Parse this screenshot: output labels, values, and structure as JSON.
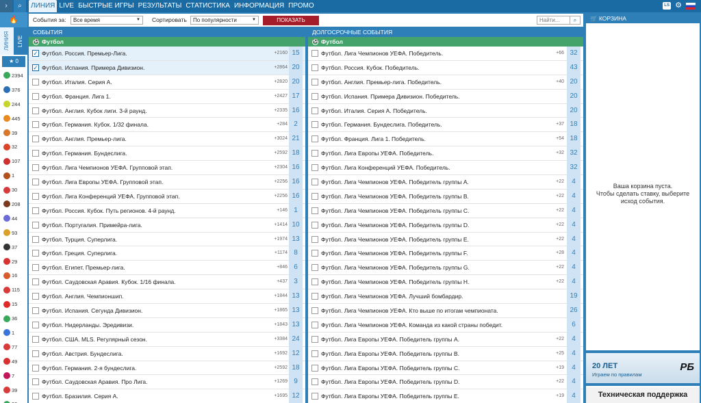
{
  "topbar": {
    "menu_icon": "chevron-right-icon",
    "search_icon": "search-icon",
    "nav": [
      "ЛИНИЯ",
      "LIVE",
      "БЫСТРЫЕ ИГРЫ",
      "РЕЗУЛЬТАТЫ",
      "СТАТИСТИКА",
      "ИНФОРМАЦИЯ",
      "ПРОМО"
    ],
    "ls_label": "LS",
    "settings_icon": "gear-icon",
    "flag_icon": "russian-flag-icon"
  },
  "leftrail": {
    "fire_icon": "fire-icon",
    "tab_line": "ЛИНИЯ",
    "tab_live": "LIVE",
    "favorites_count": "0",
    "sports": [
      {
        "icon": "soccer-ball-icon",
        "count": "2394",
        "color": "#3aa85a"
      },
      {
        "icon": "hockey-puck-icon",
        "count": "376",
        "color": "#2b6fb5"
      },
      {
        "icon": "tennis-ball-icon",
        "count": "244",
        "color": "#c5d52a"
      },
      {
        "icon": "basketball-icon",
        "count": "445",
        "color": "#e88a1f"
      },
      {
        "icon": "volleyball-icon",
        "count": "39",
        "color": "#d9772a"
      },
      {
        "icon": "ski-icon",
        "count": "32",
        "color": "#d9452a"
      },
      {
        "icon": "gamepad-icon",
        "count": "107",
        "color": "#d02f2f"
      },
      {
        "icon": "rugby-ball-icon",
        "count": "1",
        "color": "#b3501f"
      },
      {
        "icon": "flag-icon",
        "count": "30",
        "color": "#d63a3a"
      },
      {
        "icon": "american-football-icon",
        "count": "208",
        "color": "#7a3a20"
      },
      {
        "icon": "badminton-icon",
        "count": "44",
        "color": "#6b6bd9"
      },
      {
        "icon": "cricket-icon",
        "count": "93",
        "color": "#d9a02a"
      },
      {
        "icon": "snooker-icon",
        "count": "37",
        "color": "#333333"
      },
      {
        "icon": "boxing-glove-icon",
        "count": "29",
        "color": "#d93030"
      },
      {
        "icon": "handball-icon",
        "count": "16",
        "color": "#d95a2a"
      },
      {
        "icon": "athletics-icon",
        "count": "115",
        "color": "#d93a3a"
      },
      {
        "icon": "darts-icon",
        "count": "15",
        "color": "#e02a2a"
      },
      {
        "icon": "alpine-icon",
        "count": "36",
        "color": "#3aa85a"
      },
      {
        "icon": "olympic-rings-icon",
        "count": "1",
        "color": "#3a73d9"
      },
      {
        "icon": "hurdles-icon",
        "count": "77",
        "color": "#d93a3a"
      },
      {
        "icon": "table-tennis-icon",
        "count": "49",
        "color": "#d93030"
      },
      {
        "icon": "water-polo-icon",
        "count": "7",
        "color": "#c2185b"
      },
      {
        "icon": "motorsport-icon",
        "count": "39",
        "color": "#d93a3a"
      },
      {
        "icon": "futsal-icon",
        "count": "30",
        "color": "#3aa85a"
      }
    ]
  },
  "filters": {
    "events_label": "События за:",
    "events_value": "Все время",
    "sort_label": "Сортировать",
    "sort_value": "По популярности",
    "show_button": "ПОКАЗАТЬ",
    "search_placeholder": "Найти..."
  },
  "events": {
    "header": "СОБЫТИЯ",
    "sport": "Футбол",
    "rows": [
      {
        "name": "Футбол. Россия. Премьер-Лига.",
        "plus": "+2160",
        "count": "15",
        "checked": true
      },
      {
        "name": "Футбол. Испания. Примера Дивизион.",
        "plus": "+2864",
        "count": "20",
        "checked": true
      },
      {
        "name": "Футбол. Италия. Серия А.",
        "plus": "+2820",
        "count": "20",
        "checked": false
      },
      {
        "name": "Футбол. Франция. Лига 1.",
        "plus": "+2427",
        "count": "17",
        "checked": false
      },
      {
        "name": "Футбол. Англия. Кубок лиги. 3-й раунд.",
        "plus": "+2335",
        "count": "16",
        "checked": false
      },
      {
        "name": "Футбол. Германия. Кубок. 1/32 финала.",
        "plus": "+284",
        "count": "2",
        "checked": false
      },
      {
        "name": "Футбол. Англия. Премьер-лига.",
        "plus": "+3024",
        "count": "21",
        "checked": false
      },
      {
        "name": "Футбол. Германия. Бундеслига.",
        "plus": "+2592",
        "count": "18",
        "checked": false
      },
      {
        "name": "Футбол. Лига Чемпионов УЕФА. Групповой этап.",
        "plus": "+2304",
        "count": "16",
        "checked": false
      },
      {
        "name": "Футбол. Лига Европы УЕФА. Групповой этап.",
        "plus": "+2256",
        "count": "16",
        "checked": false
      },
      {
        "name": "Футбол. Лига Конференций УЕФА. Групповой этап.",
        "plus": "+2256",
        "count": "16",
        "checked": false
      },
      {
        "name": "Футбол. Россия. Кубок. Путь регионов. 4-й раунд.",
        "plus": "+146",
        "count": "1",
        "checked": false
      },
      {
        "name": "Футбол. Португалия. Примейра-лига.",
        "plus": "+1414",
        "count": "10",
        "checked": false
      },
      {
        "name": "Футбол. Турция. Суперлига.",
        "plus": "+1974",
        "count": "13",
        "checked": false
      },
      {
        "name": "Футбол. Греция. Суперлига.",
        "plus": "+1174",
        "count": "8",
        "checked": false
      },
      {
        "name": "Футбол. Египет. Премьер-лига.",
        "plus": "+846",
        "count": "6",
        "checked": false
      },
      {
        "name": "Футбол. Саудовская Аравия. Кубок. 1/16 финала.",
        "plus": "+437",
        "count": "3",
        "checked": false
      },
      {
        "name": "Футбол. Англия. Чемпионшип.",
        "plus": "+1844",
        "count": "13",
        "checked": false
      },
      {
        "name": "Футбол. Испания. Сегунда Дивизион.",
        "plus": "+1865",
        "count": "13",
        "checked": false
      },
      {
        "name": "Футбол. Нидерланды. Эредивизи.",
        "plus": "+1843",
        "count": "13",
        "checked": false
      },
      {
        "name": "Футбол. США. MLS. Регулярный сезон.",
        "plus": "+3384",
        "count": "24",
        "checked": false
      },
      {
        "name": "Футбол. Австрия. Бундеслига.",
        "plus": "+1692",
        "count": "12",
        "checked": false
      },
      {
        "name": "Футбол. Германия. 2-я бундеслига.",
        "plus": "+2592",
        "count": "18",
        "checked": false
      },
      {
        "name": "Футбол. Саудовская Аравия. Про Лига.",
        "plus": "+1269",
        "count": "9",
        "checked": false
      },
      {
        "name": "Футбол. Бразилия. Серия А.",
        "plus": "+1695",
        "count": "12",
        "checked": false
      }
    ]
  },
  "longterm": {
    "header": "ДОЛГОСРОЧНЫЕ СОБЫТИЯ",
    "sport": "Футбол",
    "rows": [
      {
        "name": "Футбол. Лига Чемпионов УЕФА. Победитель.",
        "plus": "+66",
        "count": "32"
      },
      {
        "name": "Футбол. Россия. Кубок. Победитель.",
        "plus": "",
        "count": "43"
      },
      {
        "name": "Футбол. Англия. Премьер-лига. Победитель.",
        "plus": "+40",
        "count": "20"
      },
      {
        "name": "Футбол. Испания. Примера Дивизион. Победитель.",
        "plus": "",
        "count": "20"
      },
      {
        "name": "Футбол. Италия. Серия А. Победитель.",
        "plus": "",
        "count": "20"
      },
      {
        "name": "Футбол. Германия. Бундеслига. Победитель.",
        "plus": "+37",
        "count": "18"
      },
      {
        "name": "Футбол. Франция. Лига 1. Победитель.",
        "plus": "+54",
        "count": "18"
      },
      {
        "name": "Футбол. Лига Европы УЕФА. Победитель.",
        "plus": "+32",
        "count": "32"
      },
      {
        "name": "Футбол. Лига Конференций УЕФА. Победитель.",
        "plus": "",
        "count": "32"
      },
      {
        "name": "Футбол. Лига Чемпионов УЕФА. Победитель группы A.",
        "plus": "+22",
        "count": "4"
      },
      {
        "name": "Футбол. Лига Чемпионов УЕФА. Победитель группы B.",
        "plus": "+22",
        "count": "4"
      },
      {
        "name": "Футбол. Лига Чемпионов УЕФА. Победитель группы C.",
        "plus": "+22",
        "count": "4"
      },
      {
        "name": "Футбол. Лига Чемпионов УЕФА. Победитель группы D.",
        "plus": "+22",
        "count": "4"
      },
      {
        "name": "Футбол. Лига Чемпионов УЕФА. Победитель группы E.",
        "plus": "+22",
        "count": "4"
      },
      {
        "name": "Футбол. Лига Чемпионов УЕФА. Победитель группы F.",
        "plus": "+28",
        "count": "4"
      },
      {
        "name": "Футбол. Лига Чемпионов УЕФА. Победитель группы G.",
        "plus": "+22",
        "count": "4"
      },
      {
        "name": "Футбол. Лига Чемпионов УЕФА. Победитель группы H.",
        "plus": "+22",
        "count": "4"
      },
      {
        "name": "Футбол. Лига Чемпионов УЕФА. Лучший бомбардир.",
        "plus": "",
        "count": "19"
      },
      {
        "name": "Футбол. Лига Чемпионов УЕФА. Кто выше по итогам чемпионата.",
        "plus": "",
        "count": "26"
      },
      {
        "name": "Футбол. Лига Чемпионов УЕФА. Команда из какой страны победит.",
        "plus": "",
        "count": "6"
      },
      {
        "name": "Футбол. Лига Европы УЕФА. Победитель группы A.",
        "plus": "+22",
        "count": "4"
      },
      {
        "name": "Футбол. Лига Европы УЕФА. Победитель группы B.",
        "plus": "+25",
        "count": "4"
      },
      {
        "name": "Футбол. Лига Европы УЕФА. Победитель группы C.",
        "plus": "+19",
        "count": "4"
      },
      {
        "name": "Футбол. Лига Европы УЕФА. Победитель группы D.",
        "plus": "+22",
        "count": "4"
      },
      {
        "name": "Футбол. Лига Европы УЕФА. Победитель группы E.",
        "plus": "+19",
        "count": "4"
      }
    ]
  },
  "cart": {
    "header": "КОРЗИНА",
    "cart_icon": "shopping-cart-icon",
    "empty_line1": "Ваша корзина пуста.",
    "empty_line2": "Чтобы сделать ставку, выберите",
    "empty_line3": "исход события."
  },
  "promo": {
    "title": "20 ЛЕТ",
    "subtitle": "Играем по правилам",
    "logo": "РБ"
  },
  "support": {
    "label": "Техническая поддержка"
  }
}
